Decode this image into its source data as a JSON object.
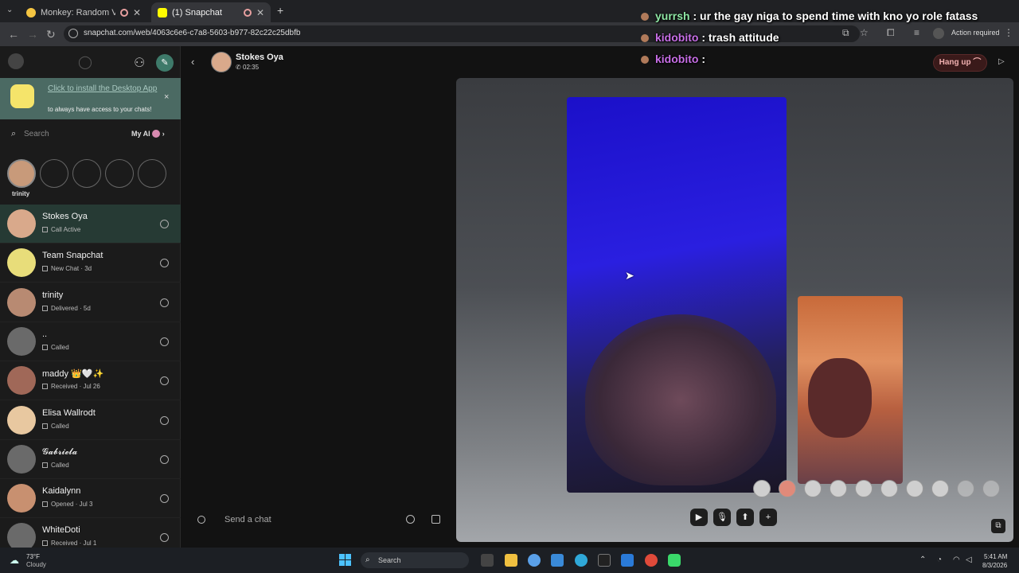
{
  "browser": {
    "tabs": [
      {
        "title": "Monkey: Random Video Ch",
        "active": false
      },
      {
        "title": "(1) Snapchat",
        "active": true
      }
    ],
    "new_tab": "+",
    "url": "snapchat.com/web/4063c6e6-c7a8-5603-b977-82c22c25dbfb",
    "action_required": "Action required"
  },
  "overlay_chat": [
    {
      "user": "yurrsh",
      "text": ": ur the gay niga to spend time with kno yo role fatass"
    },
    {
      "user": "kidobito",
      "text": ": trash attitude"
    },
    {
      "user": "kidobito",
      "text": ":"
    }
  ],
  "sidebar": {
    "install_banner": {
      "link": "Click to install the Desktop App",
      "sub": "to always have access to your chats!",
      "close": "×"
    },
    "search_placeholder": "Search",
    "my_ai": "My AI",
    "story_name": "trinity",
    "chats": [
      {
        "name": "Stokes Oya",
        "status": "Call Active",
        "selected": true,
        "avatar_color": "#d9a98b"
      },
      {
        "name": "Team Snapchat",
        "status": "New Chat · 3d",
        "selected": false,
        "avatar_color": "#e8dd7a"
      },
      {
        "name": "trinity",
        "status": "Delivered · 5d",
        "selected": false,
        "avatar_color": "#b88a72"
      },
      {
        "name": "..",
        "status": "Called",
        "selected": false,
        "avatar_color": "#6a6a6a"
      },
      {
        "name": "maddy 👑🤍✨",
        "status": "Received · Jul 26",
        "selected": false,
        "avatar_color": "#a06858"
      },
      {
        "name": "Elisa Wallrodt",
        "status": "Called",
        "selected": false,
        "avatar_color": "#e8c8a0"
      },
      {
        "name": "𝓖𝓪𝓫𝓻𝓲𝓮𝓵𝓪",
        "status": "Called",
        "selected": false,
        "avatar_color": "#6a6a6a"
      },
      {
        "name": "Kaidalynn",
        "status": "Opened · Jul 3",
        "selected": false,
        "avatar_color": "#c89070"
      },
      {
        "name": "WhiteDoti",
        "status": "Received · Jul 1",
        "selected": false,
        "avatar_color": "#6a6a6a"
      }
    ]
  },
  "chat": {
    "caller_name": "Stokes Oya",
    "call_timer": "02:35",
    "send_placeholder": "Send a chat"
  },
  "call": {
    "hang_up": "Hang up",
    "lens_count": 10
  },
  "taskbar": {
    "temperature": "73°F",
    "condition": "Cloudy",
    "search": "Search",
    "time": "5:41 AM",
    "date": "8/3/2026"
  }
}
